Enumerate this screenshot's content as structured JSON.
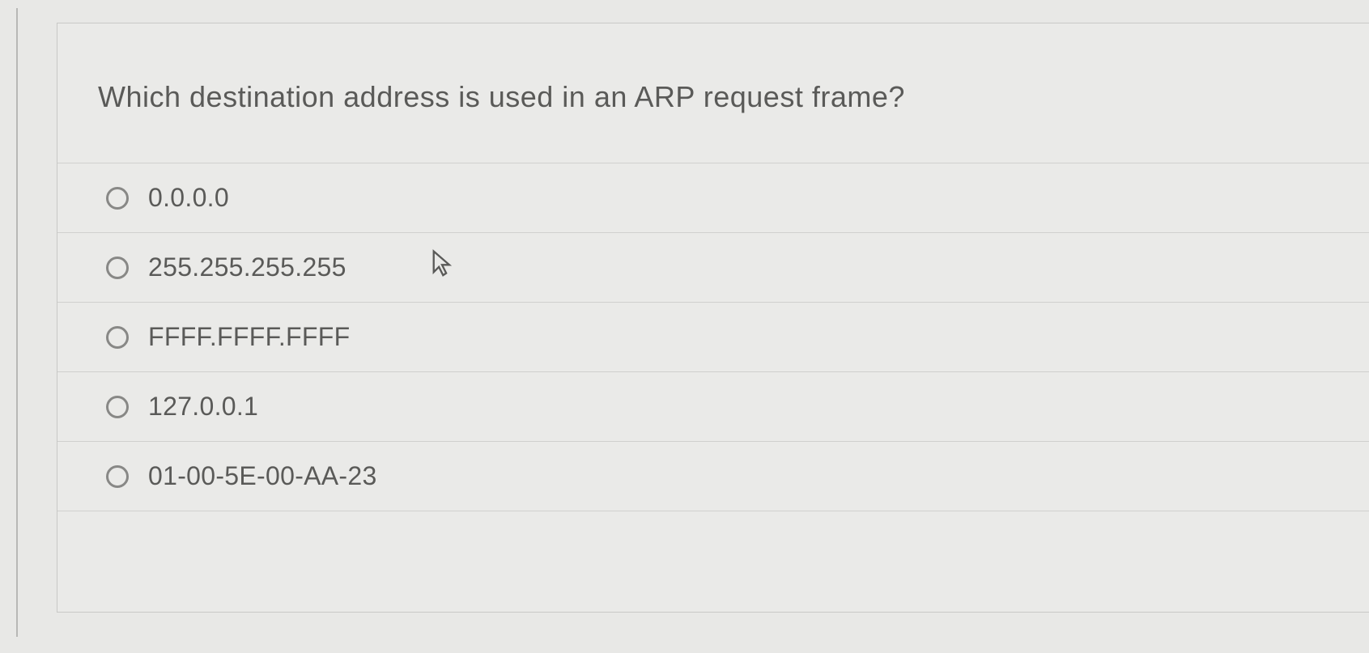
{
  "question": {
    "text": "Which destination address is used in an ARP request frame?"
  },
  "options": [
    {
      "label": "0.0.0.0"
    },
    {
      "label": "255.255.255.255"
    },
    {
      "label": "FFFF.FFFF.FFFF"
    },
    {
      "label": "127.0.0.1"
    },
    {
      "label": "01-00-5E-00-AA-23"
    }
  ]
}
